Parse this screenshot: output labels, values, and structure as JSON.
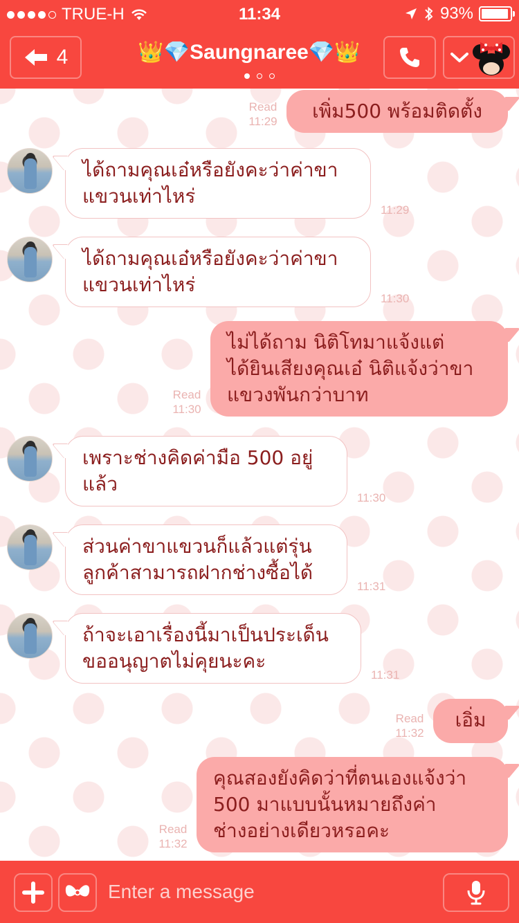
{
  "status_bar": {
    "carrier": "TRUE-H",
    "time": "11:34",
    "battery": "93%"
  },
  "header": {
    "back_count": "4",
    "title": "👑💎Saungnaree💎👑"
  },
  "messages": [
    {
      "dir": "out",
      "text": "เพิ่ม500 พร้อมติดตั้ง",
      "read": "Read",
      "time": "11:29"
    },
    {
      "dir": "in",
      "lines": [
        "ได้ถามคุณเอ๋หรือยังคะว่าค่าขา",
        "แขวนเท่าไหร่"
      ],
      "time": "11:29"
    },
    {
      "dir": "in",
      "lines": [
        "ได้ถามคุณเอ๋หรือยังคะว่าค่าขา",
        "แขวนเท่าไหร่"
      ],
      "time": "11:30"
    },
    {
      "dir": "out",
      "lines": [
        "ไม่ได้ถาม นิติโทมาแจ้งแต่",
        "ได้ยินเสียงคุณเอ๋ นิติแจ้งว่าขา",
        "แขวงพันกว่าบาท"
      ],
      "read": "Read",
      "time": "11:30"
    },
    {
      "dir": "in",
      "lines": [
        "เพราะช่างคิดค่ามือ 500 อยู่",
        "แล้ว"
      ],
      "time": "11:30"
    },
    {
      "dir": "in",
      "lines": [
        "ส่วนค่าขาแขวนก็แล้วแต่รุ่น",
        "ลูกค้าสามารถฝากช่างซื้อได้"
      ],
      "time": "11:31"
    },
    {
      "dir": "in",
      "lines": [
        "ถ้าจะเอาเรื่องนี้มาเป็นประเด็น",
        "ขออนุญาตไม่คุยนะคะ"
      ],
      "time": "11:31"
    },
    {
      "dir": "out",
      "text": "เอิ่ม",
      "read": "Read",
      "time": "11:32"
    },
    {
      "dir": "out",
      "lines": [
        "คุณสองยังคิดว่าที่ตนเองแจ้งว่า",
        "500 มาแบบนั้นหมายถึงค่า",
        "ช่างอย่างเดียวหรอคะ"
      ],
      "read": "Read",
      "time": "11:32"
    }
  ],
  "input": {
    "placeholder": "Enter a message"
  }
}
